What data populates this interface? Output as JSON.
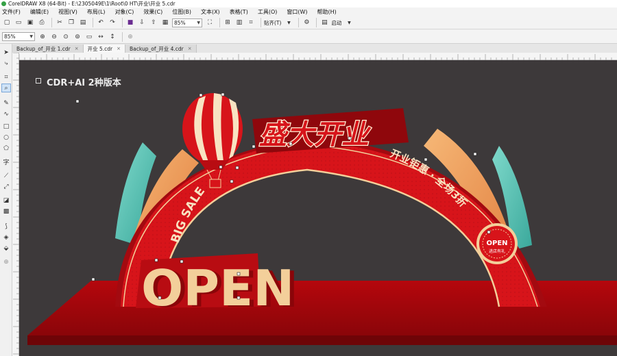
{
  "window": {
    "title": "CorelDRAW X8 (64-Bit) - E:\\2305049E\\1\\Root\\0 HT\\开业\\开业 5.cdr"
  },
  "menu": [
    "文件(F)",
    "编辑(E)",
    "视图(V)",
    "布局(L)",
    "对象(C)",
    "效果(C)",
    "位图(B)",
    "文本(X)",
    "表格(T)",
    "工具(O)",
    "窗口(W)",
    "帮助(H)"
  ],
  "toolbar": {
    "zoom_value": "85%",
    "snap_label": "贴齐(T)",
    "launch_label": "启动"
  },
  "zoom_bar": {
    "zoom_value": "85%"
  },
  "tabs": [
    "Backup_of_开业 1.cdr",
    "开业 5.cdr",
    "Backup_of_开业 4.cdr"
  ],
  "artwork": {
    "top_label": "CDR+AI 2种版本",
    "headline": "盛大开业",
    "big_sale": "BIG SALE",
    "promo": "开业钜惠 · 全场3折",
    "open_text": "OPEN",
    "badge_title": "OPEN",
    "badge_sub": "进店有礼"
  },
  "colors": {
    "canvas_bg": "#3d393a",
    "red_primary": "#d7141a",
    "red_dark": "#9c0a10",
    "cream": "#f3cf9a",
    "teal": "#5cc4b8",
    "orange": "#f0a060"
  }
}
